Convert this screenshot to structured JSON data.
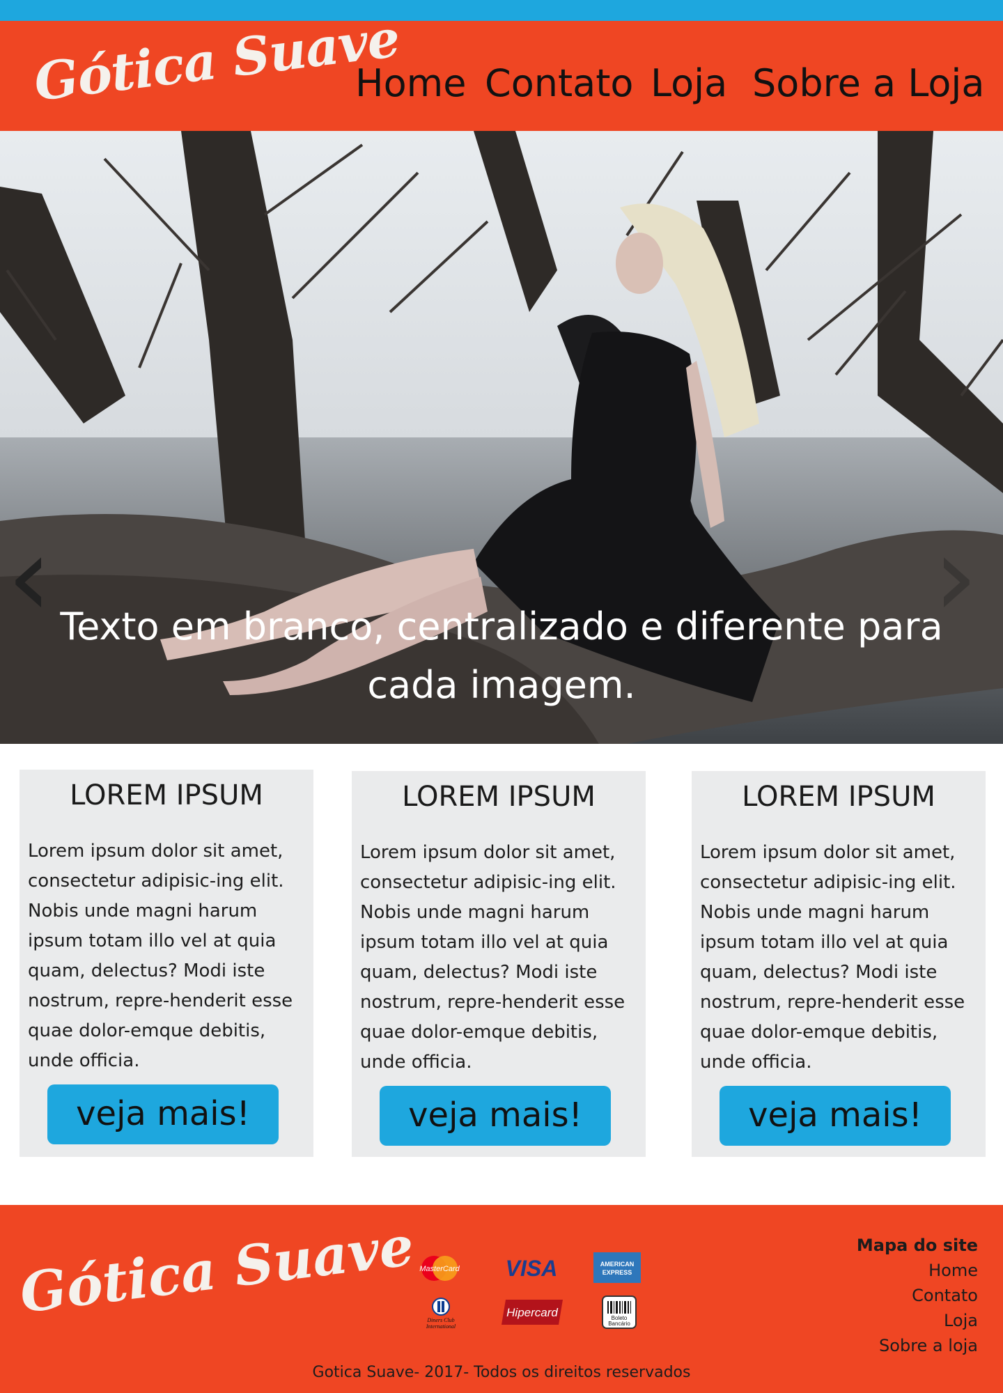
{
  "brand": {
    "logo_text": "Gótica Suave",
    "colors": {
      "accent": "#ef4623",
      "strip": "#1ea7de",
      "button": "#1ea7de",
      "card_bg": "#eaebec"
    }
  },
  "nav": {
    "items": [
      "Home",
      "Contato",
      "Loja",
      "Sobre a Loja"
    ]
  },
  "hero": {
    "caption": "Texto em branco, centralizado e diferente para cada imagem.",
    "prev_icon": "chevron-left-icon",
    "next_icon": "chevron-right-icon"
  },
  "cards": [
    {
      "title": "LOREM IPSUM",
      "text": "Lorem ipsum dolor sit amet, consectetur adipisic-ing elit. Nobis unde magni harum ipsum totam illo vel at quia quam, delectus? Modi iste nostrum, repre-henderit esse quae dolor-emque debitis, unde officia.",
      "button": "veja mais!"
    },
    {
      "title": "LOREM IPSUM",
      "text": "Lorem ipsum dolor sit amet, consectetur adipisic-ing elit. Nobis unde magni harum ipsum totam illo vel at quia quam, delectus? Modi iste nostrum, repre-henderit esse quae dolor-emque debitis, unde officia.",
      "button": "veja mais!"
    },
    {
      "title": "LOREM IPSUM",
      "text": "Lorem ipsum dolor sit amet, consectetur adipisic-ing elit. Nobis unde magni harum ipsum totam illo vel at quia quam, delectus? Modi iste nostrum, repre-henderit esse quae dolor-emque debitis, unde officia.",
      "button": "veja mais!"
    }
  ],
  "footer": {
    "logo_text": "Gótica Suave",
    "payments": [
      "MasterCard",
      "VISA",
      "AMERICAN EXPRESS",
      "Diners Club International",
      "Hipercard",
      "Boleto Bancário"
    ],
    "sitemap": {
      "title": "Mapa do site",
      "links": [
        "Home",
        "Contato",
        "Loja",
        "Sobre a loja"
      ]
    },
    "copyright": "Gotica Suave- 2017- Todos os direitos reservados"
  }
}
